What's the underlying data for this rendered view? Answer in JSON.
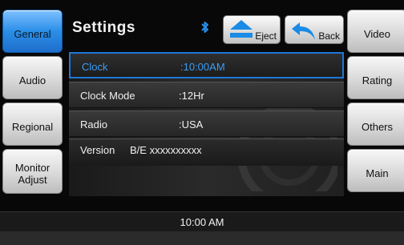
{
  "header": {
    "title": "Settings",
    "eject_label": "Eject",
    "back_label": "Back",
    "bluetooth_icon": "bluetooth-icon"
  },
  "left_nav": [
    {
      "label": "General",
      "active": true
    },
    {
      "label": "Audio"
    },
    {
      "label": "Regional"
    },
    {
      "label": "Monitor Adjust"
    }
  ],
  "right_nav": [
    {
      "label": "Video"
    },
    {
      "label": "Rating"
    },
    {
      "label": "Others"
    },
    {
      "label": "Main"
    }
  ],
  "settings": [
    {
      "key": "Clock",
      "value": ":10:00AM",
      "selected": true
    },
    {
      "key": "Clock Mode",
      "value": ":12Hr"
    },
    {
      "key": "Radio",
      "value": ":USA"
    },
    {
      "key": "Version",
      "value": "B/E xxxxxxxxxx"
    }
  ],
  "status": {
    "time": "10:00 AM"
  },
  "colors": {
    "accent": "#2a8fe8",
    "selected_text": "#3a9cf5"
  }
}
